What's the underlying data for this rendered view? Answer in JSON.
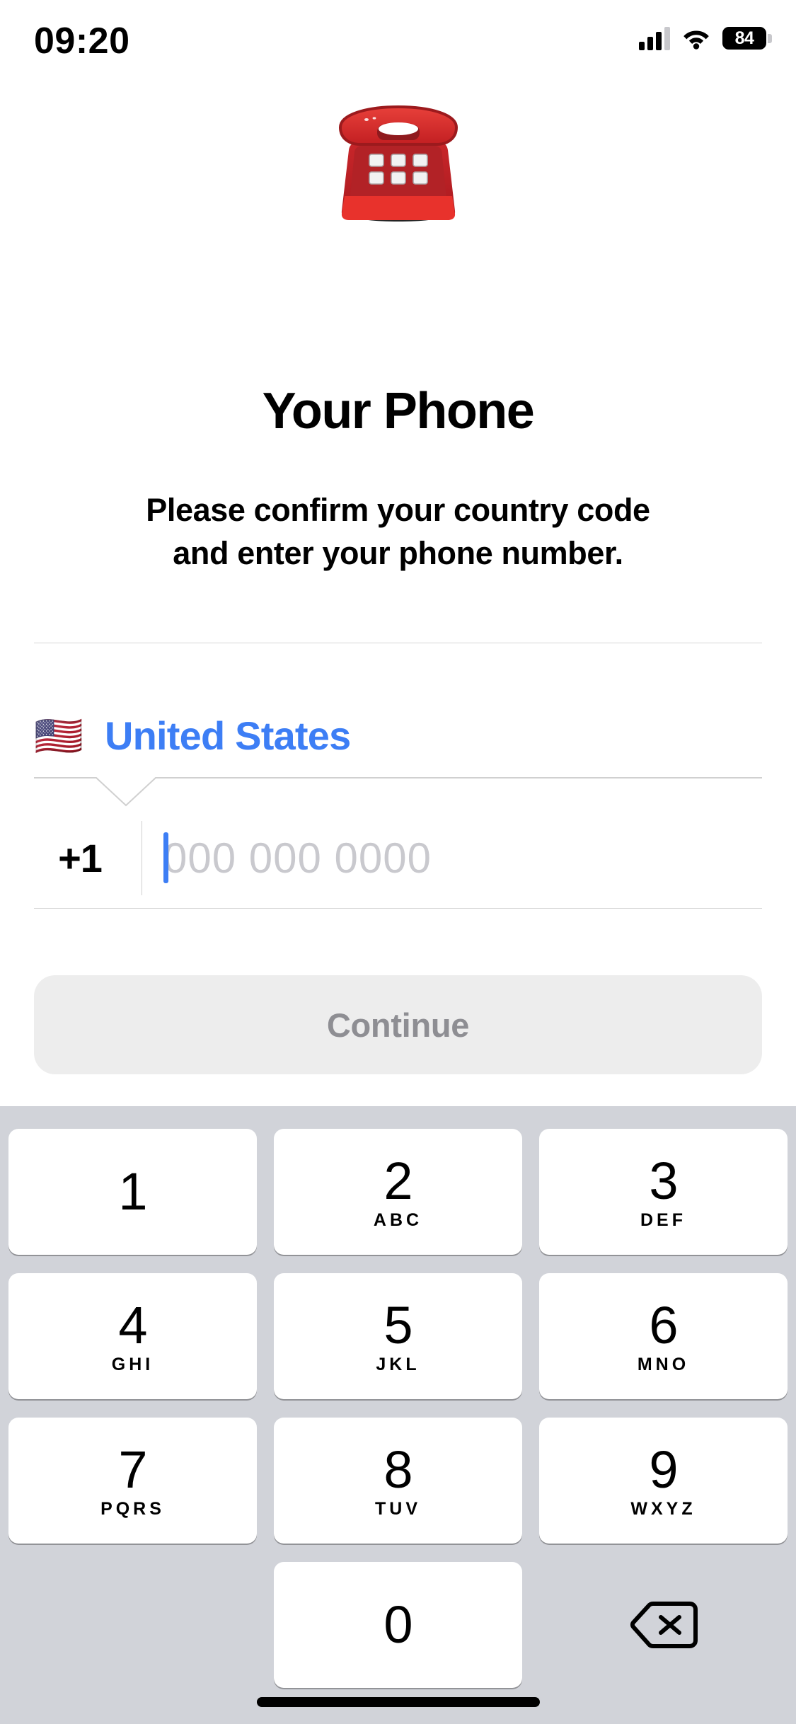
{
  "status_bar": {
    "time": "09:20",
    "battery_percent": "84",
    "signal_icon": "cellular-signal-icon",
    "wifi_icon": "wifi-icon",
    "battery_icon": "battery-icon"
  },
  "hero": {
    "emoji_icon": "telephone-emoji",
    "emoji_char": "☎️"
  },
  "content": {
    "title": "Your Phone",
    "subtitle_line1": "Please confirm your country code",
    "subtitle_line2": "and enter your phone number."
  },
  "country_selector": {
    "flag_icon": "us-flag-emoji",
    "flag_char": "🇺🇸",
    "name": "United States",
    "accent_color": "#3d7ef5"
  },
  "phone_input": {
    "dial_code": "+1",
    "value": "",
    "placeholder": "000 000 0000",
    "caret_color": "#3d7ef5",
    "placeholder_color": "#c9c9ce"
  },
  "actions": {
    "continue_label": "Continue",
    "continue_enabled": false,
    "continue_bg": "#ededed",
    "continue_text_color": "#8e8e93"
  },
  "keypad": {
    "background_color": "#d1d3d9",
    "key_color": "#ffffff",
    "keys": [
      {
        "digit": "1",
        "letters": ""
      },
      {
        "digit": "2",
        "letters": "ABC"
      },
      {
        "digit": "3",
        "letters": "DEF"
      },
      {
        "digit": "4",
        "letters": "GHI"
      },
      {
        "digit": "5",
        "letters": "JKL"
      },
      {
        "digit": "6",
        "letters": "MNO"
      },
      {
        "digit": "7",
        "letters": "PQRS"
      },
      {
        "digit": "8",
        "letters": "TUV"
      },
      {
        "digit": "9",
        "letters": "WXYZ"
      },
      {
        "digit": "0",
        "letters": ""
      }
    ],
    "backspace_icon": "backspace-delete-icon"
  },
  "home_indicator": {
    "icon": "home-indicator"
  }
}
